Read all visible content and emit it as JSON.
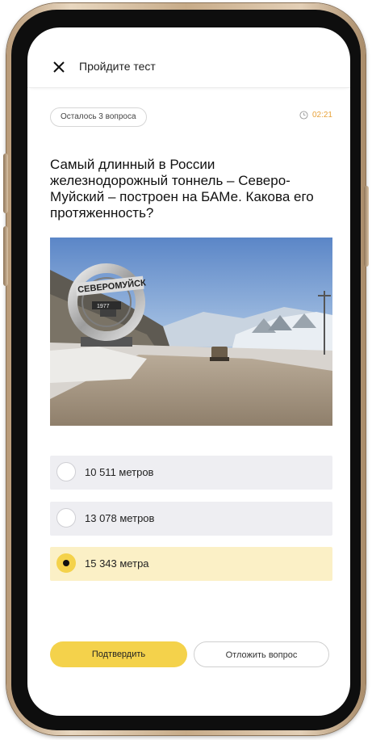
{
  "header": {
    "title": "Пройдите тест",
    "close_icon": "close-icon"
  },
  "status": {
    "remaining": "Осталось 3 вопроса",
    "timer": "02:21",
    "timer_icon": "clock-icon",
    "timer_color": "#e8a23a"
  },
  "question": {
    "text": "Самый длинный в России железнодорожный тоннель – Северо-Муйский – построен на БАМе. Какова его протяженность?",
    "image": {
      "sign_text": "СЕВЕРОМУЙСК",
      "year": "1977"
    }
  },
  "options": [
    {
      "label": "10 511 метров",
      "selected": false
    },
    {
      "label": "13 078 метров",
      "selected": false
    },
    {
      "label": "15 343 метра",
      "selected": true
    }
  ],
  "actions": {
    "confirm_label": "Подтвердить",
    "defer_label": "Отложить вопрос"
  },
  "colors": {
    "accent": "#f4d24b",
    "selected_bg": "#fbf0c6",
    "option_bg": "#eeeef2"
  }
}
